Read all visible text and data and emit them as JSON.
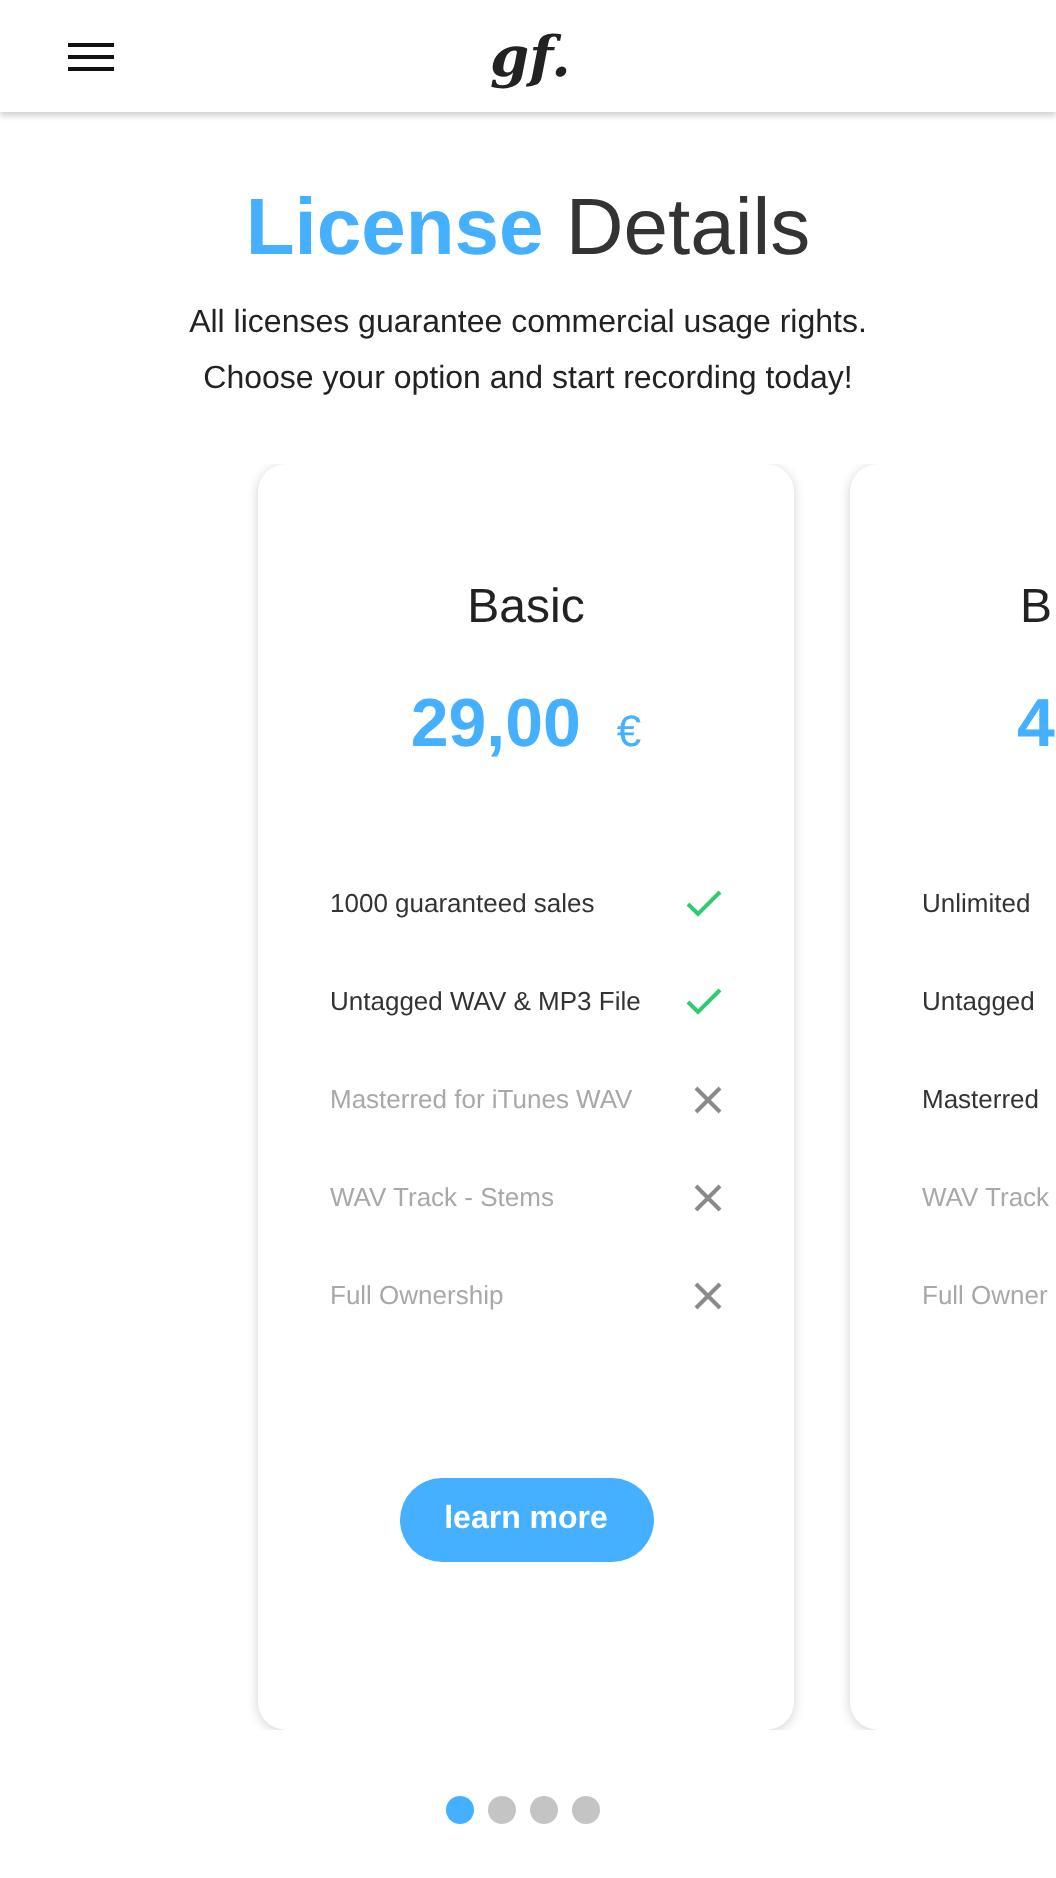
{
  "header": {
    "logo": "gf."
  },
  "heading": {
    "accent": "License",
    "rest": "Details"
  },
  "intro": [
    "All licenses guarantee commercial usage rights.",
    "Choose your option and start recording today!"
  ],
  "plans": [
    {
      "name": "Basic",
      "price": "29,00",
      "currency": "€",
      "button": "learn more",
      "features": [
        {
          "label": "1000 guaranteed sales",
          "included": true
        },
        {
          "label": "Untagged WAV & MP3 File",
          "included": true
        },
        {
          "label": "Masterred for iTunes WAV",
          "included": false
        },
        {
          "label": "WAV Track - Stems",
          "included": false
        },
        {
          "label": "Full Ownership",
          "included": false
        }
      ]
    },
    {
      "name": "B",
      "price": "4",
      "features": [
        {
          "label": "Unlimited",
          "included": true
        },
        {
          "label": "Untagged",
          "included": true
        },
        {
          "label": "Masterred",
          "included": true
        },
        {
          "label": "WAV Track",
          "included": false
        },
        {
          "label": "Full Owner",
          "included": false
        }
      ]
    }
  ],
  "pager": [
    {
      "selected": true
    },
    {
      "selected": false
    },
    {
      "selected": false
    },
    {
      "selected": false
    }
  ]
}
